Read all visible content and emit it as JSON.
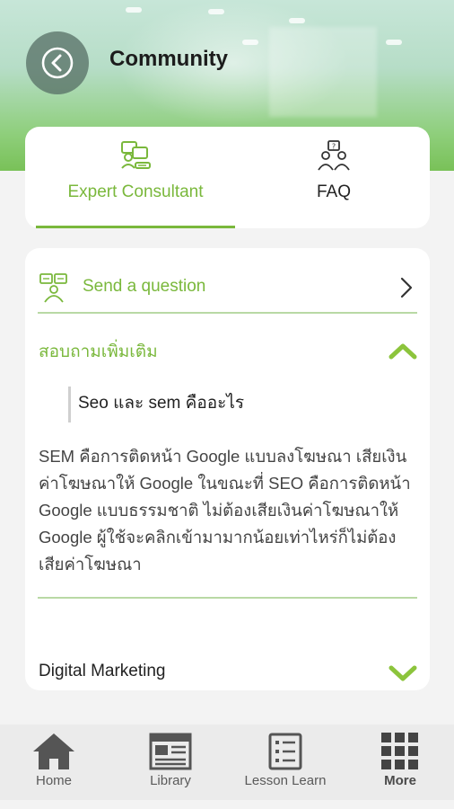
{
  "header": {
    "title": "Community",
    "back_icon": "back-arrow-icon"
  },
  "tabs": [
    {
      "label": "Expert Consultant",
      "icon": "expert-consult-icon",
      "active": true
    },
    {
      "label": "FAQ",
      "icon": "faq-people-icon",
      "active": false
    }
  ],
  "content": {
    "send_question": {
      "label": "Send a question",
      "icon": "send-question-icon"
    },
    "accordion": [
      {
        "title": "สอบถามเพิ่มเติม",
        "expanded": true,
        "question": "Seo และ sem คืออะไร",
        "answer": "SEM คือการติดหน้า Google แบบลงโฆษณา เสียเงินค่าโฆษณาให้ Google ในขณะที่ SEO คือการติดหน้า Google แบบธรรมชาติ ไม่ต้องเสียเงินค่าโฆษณาให้ Google ผู้ใช้จะคลิกเข้ามามากน้อยเท่าไหร่ก็ไม่ต้องเสียค่าโฆษณา"
      },
      {
        "title": "Digital Marketing",
        "expanded": false
      }
    ]
  },
  "bottom_nav": [
    {
      "label": "Home",
      "icon": "home-icon"
    },
    {
      "label": "Library",
      "icon": "library-icon"
    },
    {
      "label": "Lesson Learn",
      "icon": "lesson-list-icon"
    },
    {
      "label": "More",
      "icon": "grid-more-icon"
    }
  ],
  "colors": {
    "accent": "#7ab83c",
    "divider": "#b9d9a5",
    "nav_bg": "#ebebeb"
  }
}
